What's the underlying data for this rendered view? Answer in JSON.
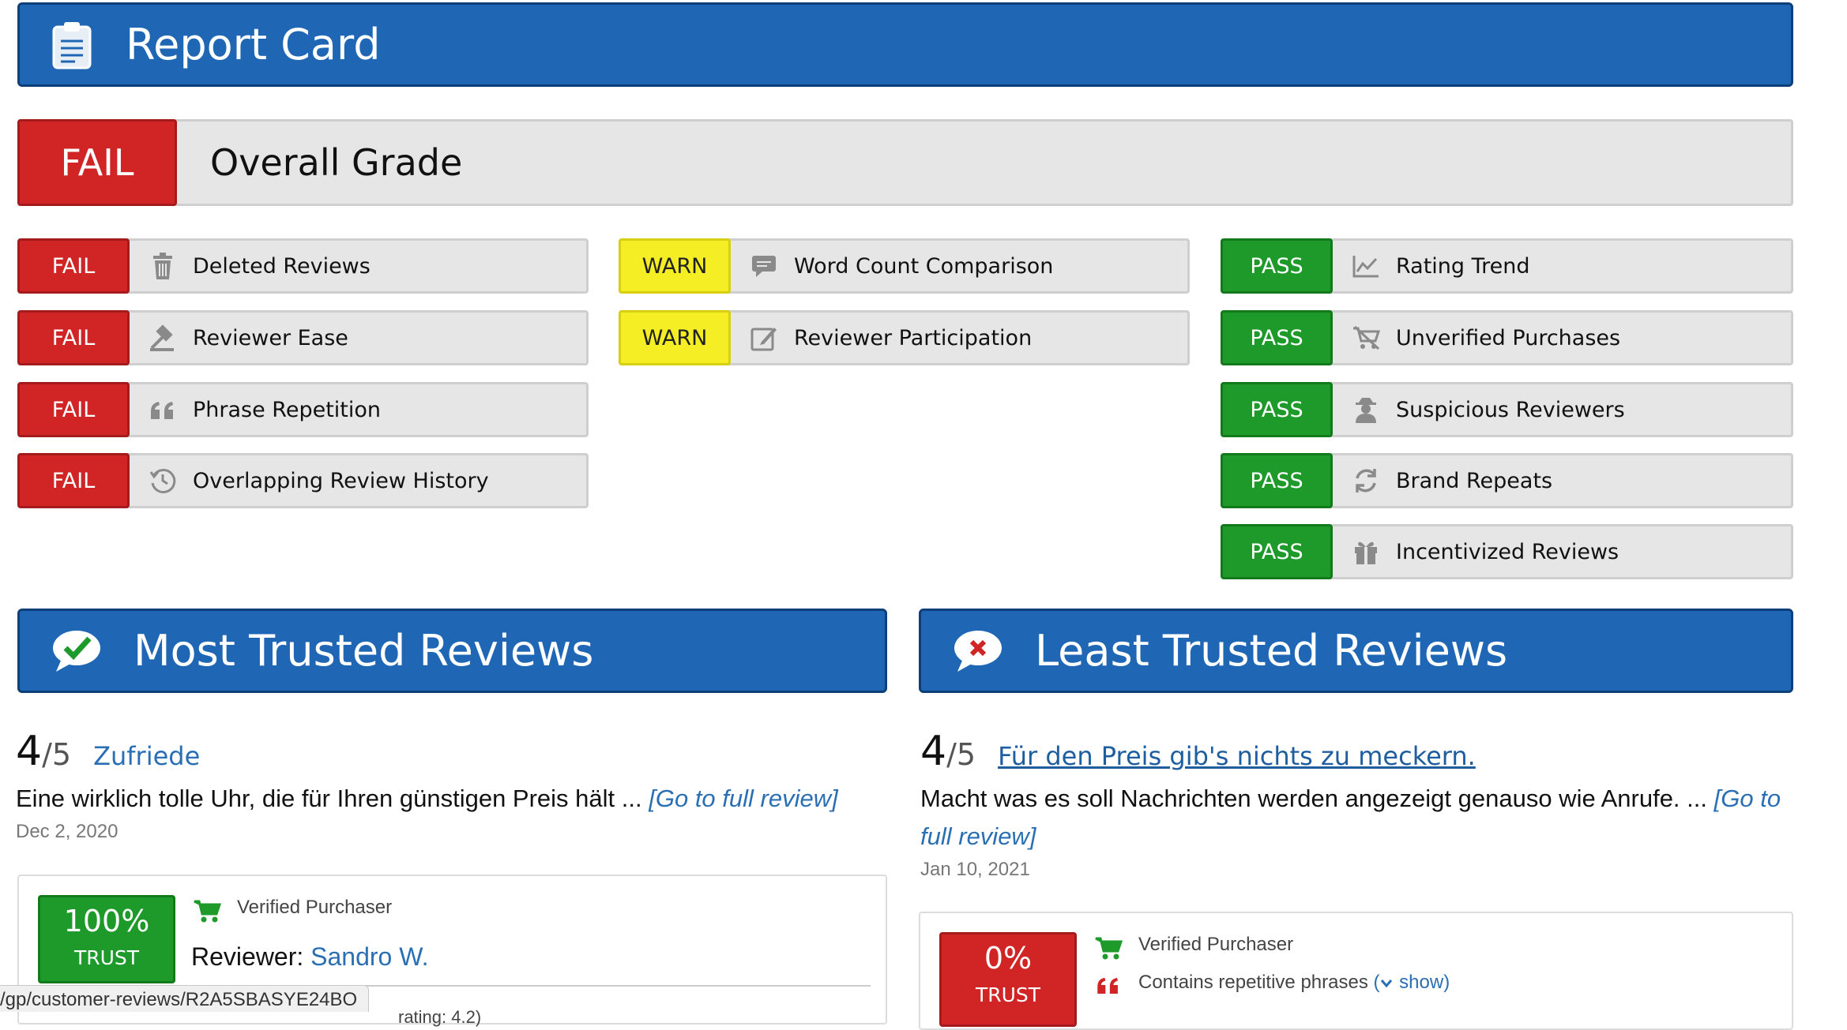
{
  "header": {
    "title": "Report Card",
    "icon": "clipboard-icon"
  },
  "overall": {
    "grade": "FAIL",
    "label": "Overall Grade"
  },
  "checks": {
    "col1": [
      {
        "status": "FAIL",
        "label": "Deleted Reviews",
        "icon": "trash-icon"
      },
      {
        "status": "FAIL",
        "label": "Reviewer Ease",
        "icon": "gavel-icon"
      },
      {
        "status": "FAIL",
        "label": "Phrase Repetition",
        "icon": "quote-icon"
      },
      {
        "status": "FAIL",
        "label": "Overlapping Review History",
        "icon": "history-icon"
      }
    ],
    "col2": [
      {
        "status": "WARN",
        "label": "Word Count Comparison",
        "icon": "comment-icon"
      },
      {
        "status": "WARN",
        "label": "Reviewer Participation",
        "icon": "edit-icon"
      }
    ],
    "col3": [
      {
        "status": "PASS",
        "label": "Rating Trend",
        "icon": "line-chart-icon"
      },
      {
        "status": "PASS",
        "label": "Unverified Purchases",
        "icon": "cart-crossed-icon"
      },
      {
        "status": "PASS",
        "label": "Suspicious Reviewers",
        "icon": "user-secret-icon"
      },
      {
        "status": "PASS",
        "label": "Brand Repeats",
        "icon": "refresh-icon"
      },
      {
        "status": "PASS",
        "label": "Incentivized Reviews",
        "icon": "gift-icon"
      }
    ]
  },
  "most_trusted": {
    "heading": "Most Trusted Reviews",
    "icon": "chat-check-icon",
    "rating": "4",
    "rating_max": "/5",
    "title": "Zufriede",
    "body": "Eine wirklich tolle Uhr, die für Ihren günstigen Preis hält ...",
    "link": "[Go to full review]",
    "date": "Dec 2, 2020",
    "trust_percent": "100%",
    "trust_label": "TRUST",
    "verified": "Verified Purchaser",
    "reviewer_prefix": "Reviewer:",
    "reviewer_name": "Sandro W.",
    "partial": "rating: 4.2)"
  },
  "least_trusted": {
    "heading": "Least Trusted Reviews",
    "icon": "chat-x-icon",
    "rating": "4",
    "rating_max": "/5",
    "title": "Für den Preis gib's nichts zu meckern.",
    "body": "Macht was es soll Nachrichten werden angezeigt genauso wie Anrufe. ...",
    "link_a": "[Go to",
    "link_b": "full review]",
    "date": "Jan 10, 2021",
    "trust_percent": "0%",
    "trust_label": "TRUST",
    "verified": "Verified Purchaser",
    "repetitive": "Contains repetitive phrases",
    "show_open": "(",
    "show_label": "show)"
  },
  "status_bar": {
    "url": "/gp/customer-reviews/R2A5SBASYE24BO"
  },
  "colors": {
    "fail": "#d12525",
    "warn": "#f5ee24",
    "pass": "#1e9a2a",
    "header": "#1f67b5"
  }
}
